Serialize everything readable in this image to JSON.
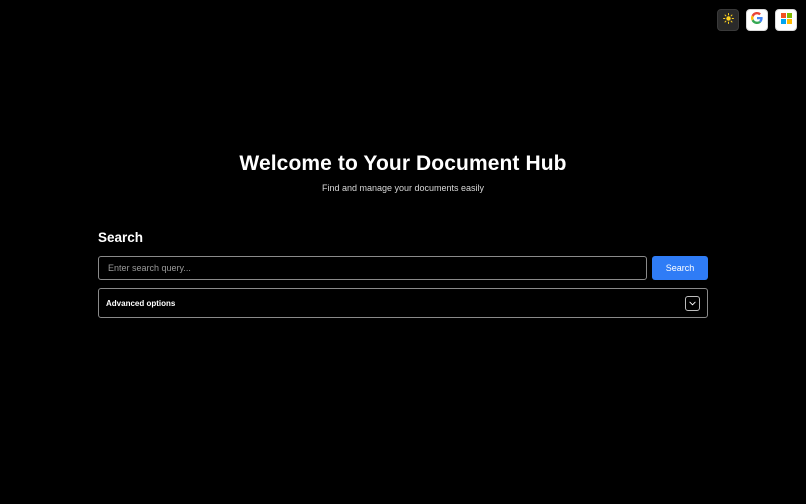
{
  "header": {
    "theme_toggle_icon": "sun-icon",
    "google_icon": "google-icon",
    "microsoft_icon": "microsoft-icon",
    "colors": {
      "sun": "#ffd21f",
      "google_blue": "#4285F4",
      "google_red": "#EA4335",
      "google_yellow": "#FBBC05",
      "google_green": "#34A853",
      "ms_red": "#F25022",
      "ms_green": "#7FBA00",
      "ms_blue": "#00A4EF",
      "ms_yellow": "#FFB900"
    }
  },
  "hero": {
    "title": "Welcome to Your Document Hub",
    "subtitle": "Find and manage your documents easily"
  },
  "search": {
    "heading": "Search",
    "placeholder": "Enter search query...",
    "value": "",
    "button_label": "Search",
    "button_color": "#2f7cf6",
    "advanced_label": "Advanced options",
    "advanced_icon": "chevron-down-icon"
  },
  "colors": {
    "background": "#000000",
    "text": "#ffffff",
    "accent": "#2f7cf6"
  }
}
